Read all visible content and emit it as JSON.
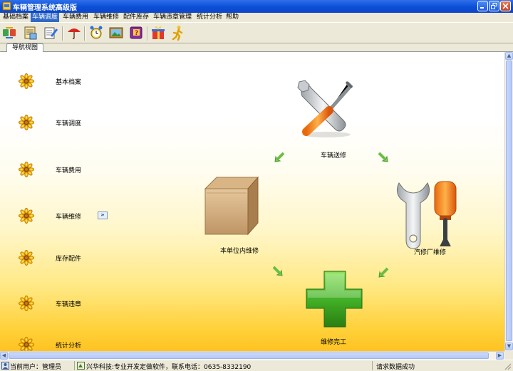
{
  "window": {
    "title": "车辆管理系统高级版"
  },
  "menu": [
    "基础档案",
    "车辆调度",
    "车辆费用",
    "车辆维修",
    "配件库存",
    "车辆违章管理",
    "统计分析",
    "帮助"
  ],
  "menu_active_index": 1,
  "tab": {
    "label": "导航视图"
  },
  "nav": [
    {
      "label": "基本档案"
    },
    {
      "label": "车辆调度"
    },
    {
      "label": "车辆费用"
    },
    {
      "label": "车辆维修"
    },
    {
      "label": "库存配件"
    },
    {
      "label": "车辆违章"
    },
    {
      "label": "统计分析"
    }
  ],
  "flow": {
    "send_repair": "车辆送修",
    "internal_repair": "本单位内维修",
    "external_repair": "汽修厂维修",
    "repair_done": "维修完工"
  },
  "status": {
    "user": "当前用户：管理员",
    "company": "兴华科技:专业开发定做软件，联系电话：0635-8332190",
    "message": "请求数据成功"
  },
  "colors": {
    "title_bar": "#0A4FD6",
    "menu_highlight": "#316AC5",
    "background_bottom": "#FFC321"
  }
}
